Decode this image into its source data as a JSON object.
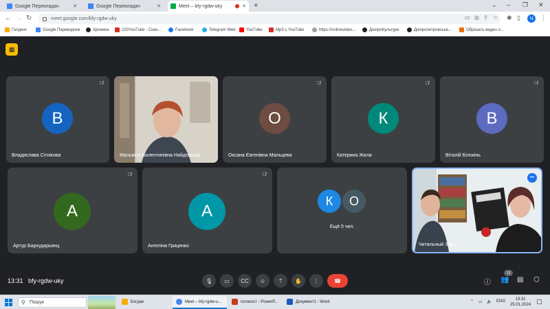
{
  "browser": {
    "tabs": [
      {
        "label": "Google Перекладач",
        "favicon_color": "#4285f4"
      },
      {
        "label": "Google Перекладач",
        "favicon_color": "#4285f4"
      },
      {
        "label": "Meet – bfy-rgdw-uky",
        "favicon_color": "#00ac47"
      }
    ],
    "new_tab": "+",
    "url": "meet.google.com/bfy-rgdw-uky",
    "profile_initial": "Ч"
  },
  "bookmarks": [
    {
      "label": "Голдинг",
      "color": "#f9ab00"
    },
    {
      "label": "Google Переводчик",
      "color": "#4285f4"
    },
    {
      "label": "Хроника",
      "color": "#202124"
    },
    {
      "label": "220YouTube - Скач...",
      "color": "#d93025"
    },
    {
      "label": "Facebook",
      "color": "#1877f2"
    },
    {
      "label": "Telegram Web",
      "color": "#2aabee"
    },
    {
      "label": "YouTube",
      "color": "#ff0000"
    },
    {
      "label": "Mp3 с YouTube",
      "color": "#d93025"
    },
    {
      "label": "https://onlinevideo...",
      "color": "#9aa0a6"
    },
    {
      "label": "ДніпроКультуре",
      "color": "#202124"
    },
    {
      "label": "Дніпропетровська...",
      "color": "#202124"
    },
    {
      "label": "Обрезать видео о...",
      "color": "#e8710a"
    }
  ],
  "participants": [
    {
      "name": "Владислава Сітнікова",
      "initial": "В",
      "color": "#1565c0"
    },
    {
      "name": "Мальвіна Валентинівна Найдовська",
      "initial": "",
      "color": ""
    },
    {
      "name": "Оксана Євгенівна Мальцева",
      "initial": "О",
      "color": "#6d4c41"
    },
    {
      "name": "Катерина Жила",
      "initial": "К",
      "color": "#00897b"
    },
    {
      "name": "Віталій Білокінь",
      "initial": "В",
      "color": "#5c6bc0"
    },
    {
      "name": "Артур Бархударьянц",
      "initial": "А",
      "color": "#33691e"
    },
    {
      "name": "Ангеліна Гриценко",
      "initial": "А",
      "color": "#0097a7"
    }
  ],
  "others": {
    "label": "Ещё 5 чел.",
    "avatars": [
      {
        "initial": "К",
        "color": "#1e88e5"
      },
      {
        "initial": "О",
        "color": "#455a64"
      }
    ]
  },
  "featured": {
    "name": "Читальный Зал"
  },
  "meeting": {
    "time": "13:31",
    "code": "bfy-rgdw-uky",
    "participant_count": "13"
  },
  "taskbar": {
    "search_label": "Пошук",
    "tasks": [
      {
        "label": "Богдан",
        "color": "#f9ab00"
      },
      {
        "label": "Meet – bfy-rgdw-u...",
        "color": "#4285f4"
      },
      {
        "label": "голокост - PowerP...",
        "color": "#c43e1c"
      },
      {
        "label": "Документ1 - Word",
        "color": "#185abd"
      }
    ],
    "language": "ENG",
    "clock_time": "13:31",
    "clock_date": "25.01.2024"
  }
}
